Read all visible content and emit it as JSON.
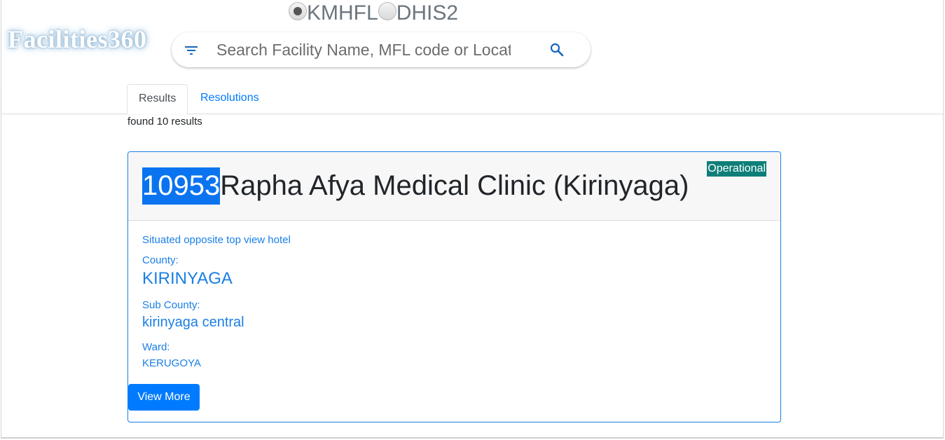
{
  "brand": {
    "name": "Facilities360"
  },
  "source_toggle": {
    "options": [
      {
        "label": "KMHFL",
        "checked": true
      },
      {
        "label": "DHIS2",
        "checked": false
      }
    ]
  },
  "search": {
    "placeholder": "Search Facility Name, MFL code or Location",
    "value": "",
    "filter_icon": "filter-list-icon",
    "search_icon": "magnifier-icon"
  },
  "tabs": [
    {
      "label": "Results",
      "active": true
    },
    {
      "label": "Resolutions",
      "active": false
    }
  ],
  "results": {
    "count_text": "found 10 results"
  },
  "facility": {
    "mfl_code": "10953",
    "name": "Rapha Afya Medical Clinic (Kirinyaga)",
    "status": "Operational",
    "directions": "Situated opposite top view hotel",
    "county_label": "County:",
    "county": "KIRINYAGA",
    "sub_county_label": "Sub County:",
    "sub_county": "kirinyaga central",
    "ward_label": "Ward:",
    "ward": "KERUGOYA",
    "view_more_label": "View More"
  },
  "colors": {
    "primary": "#007bff",
    "status_badge": "#0e7f78",
    "highlight": "#0a74f0"
  }
}
